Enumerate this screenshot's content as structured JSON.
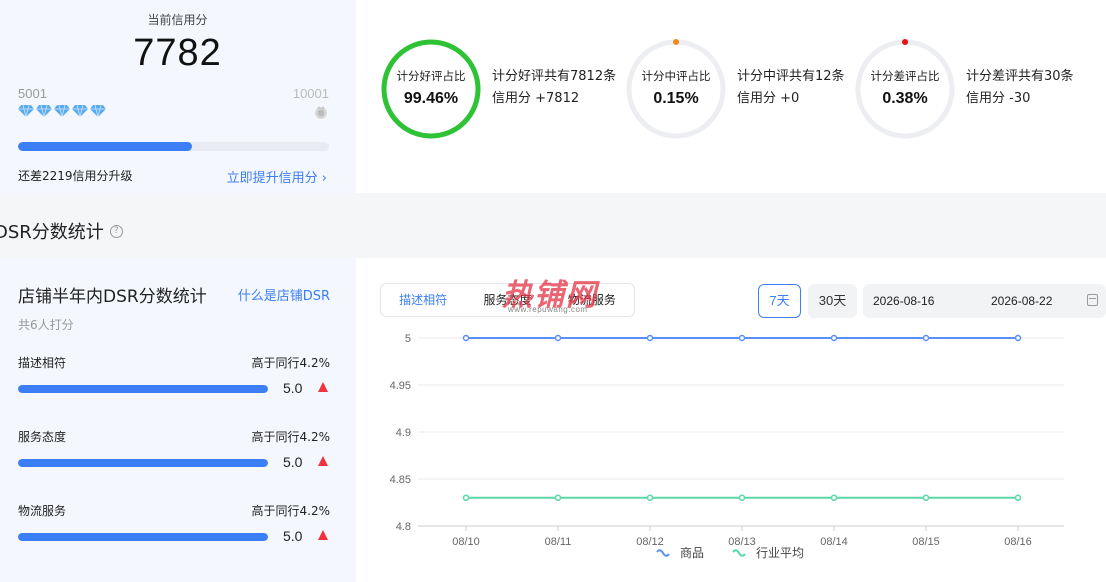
{
  "credit": {
    "label": "当前信用分",
    "score": "7782",
    "level_min": "5001",
    "level_max": "10001",
    "progress": 0.56,
    "remain_text": "还差2219信用分升级",
    "upgrade_link": "立即提升信用分",
    "diamond_count": 5,
    "colors": {
      "accent": "#3c7ef5",
      "diamond": "#5aaaf0"
    }
  },
  "ratios": [
    {
      "title": "计分好评占比",
      "value": "99.46%",
      "line1": "计分好评共有7812条",
      "line2": "信用分 +7812",
      "fraction": 1.0,
      "color": "#2ec235"
    },
    {
      "title": "计分中评占比",
      "value": "0.15%",
      "line1": "计分中评共有12条",
      "line2": "信用分 +0",
      "fraction": 0.0015,
      "color": "#f08c1e"
    },
    {
      "title": "计分差评占比",
      "value": "0.38%",
      "line1": "计分差评共有30条",
      "line2": "信用分 -30",
      "fraction": 0.0038,
      "color": "#e51414"
    }
  ],
  "dsr_section": {
    "heading": "DSR分数统计",
    "help_icon": "question-circle-icon"
  },
  "dsr_card": {
    "title": "店铺半年内DSR分数统计",
    "what_link": "什么是店铺DSR",
    "count_text": "共6人打分",
    "items": [
      {
        "name": "描述相符",
        "compare": "高于同行4.2%",
        "score": "5.0",
        "fraction": 1.0
      },
      {
        "name": "服务态度",
        "compare": "高于同行4.2%",
        "score": "5.0",
        "fraction": 1.0
      },
      {
        "name": "物流服务",
        "compare": "高于同行4.2%",
        "score": "5.0",
        "fraction": 1.0
      }
    ]
  },
  "chart_panel": {
    "tabs": [
      {
        "label": "描述相符",
        "active": true
      },
      {
        "label": "服务态度",
        "active": false
      },
      {
        "label": "物流服务",
        "active": false
      }
    ],
    "range_7": "7天",
    "range_30": "30天",
    "date_start": "2026-08-16",
    "date_end": "2026-08-22",
    "watermark": {
      "text": "热铺网",
      "url": "www.repuwang.com"
    }
  },
  "chart_data": {
    "type": "line",
    "categories": [
      "08/10",
      "08/11",
      "08/12",
      "08/13",
      "08/14",
      "08/15",
      "08/16"
    ],
    "series": [
      {
        "name": "商品",
        "values": [
          5,
          5,
          5,
          5,
          5,
          5,
          5
        ],
        "color": "#5b8ff9"
      },
      {
        "name": "行业平均",
        "values": [
          4.83,
          4.83,
          4.83,
          4.83,
          4.83,
          4.83,
          4.83
        ],
        "color": "#5ad8a6"
      }
    ],
    "yticks": [
      "5",
      "4.95",
      "4.9",
      "4.85",
      "4.8"
    ],
    "ylim": [
      4.8,
      5
    ],
    "grid": true,
    "legend": "bottom"
  }
}
